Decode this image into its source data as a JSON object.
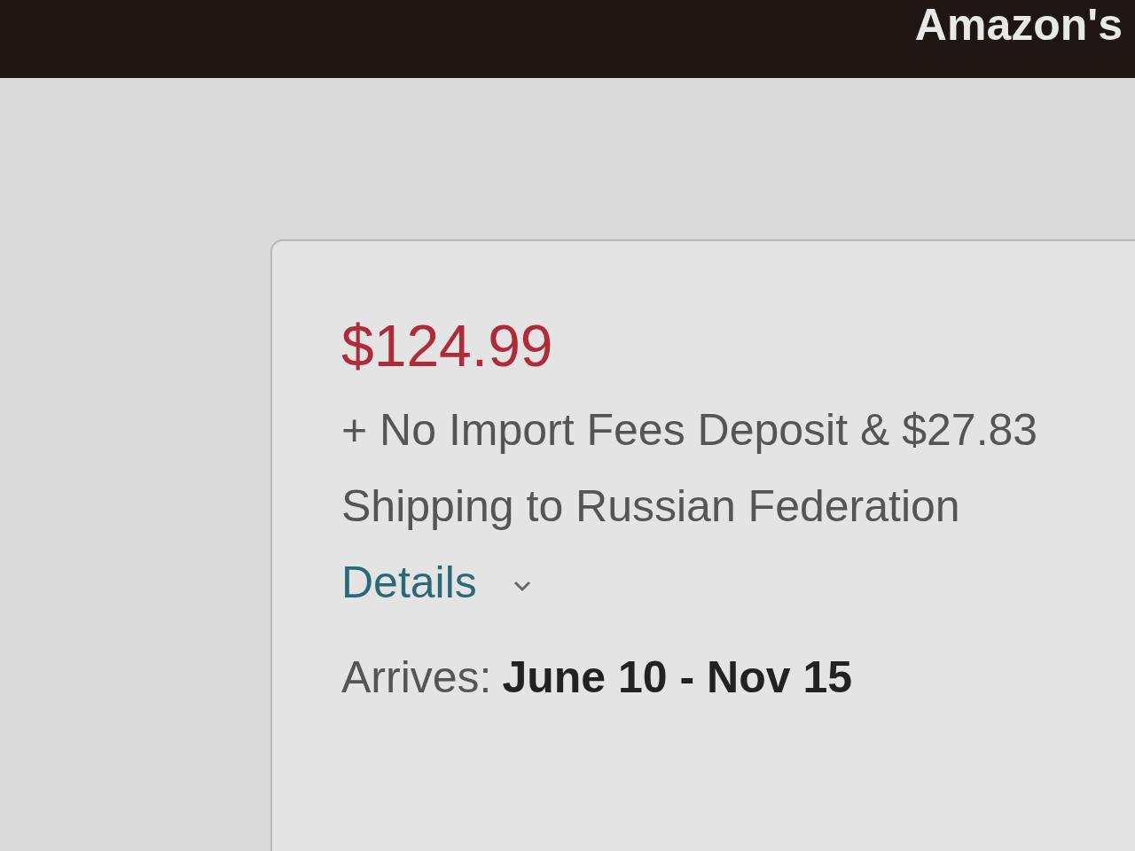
{
  "header": {
    "text": "Amazon's"
  },
  "offer": {
    "price": "$124.99",
    "shipping_note": "+ No Import Fees Deposit & $27.83 Shipping to Russian Federation",
    "details_link": "Details",
    "arrives_label": "Arrives:",
    "arrives_dates": "June 10 - Nov 15"
  }
}
